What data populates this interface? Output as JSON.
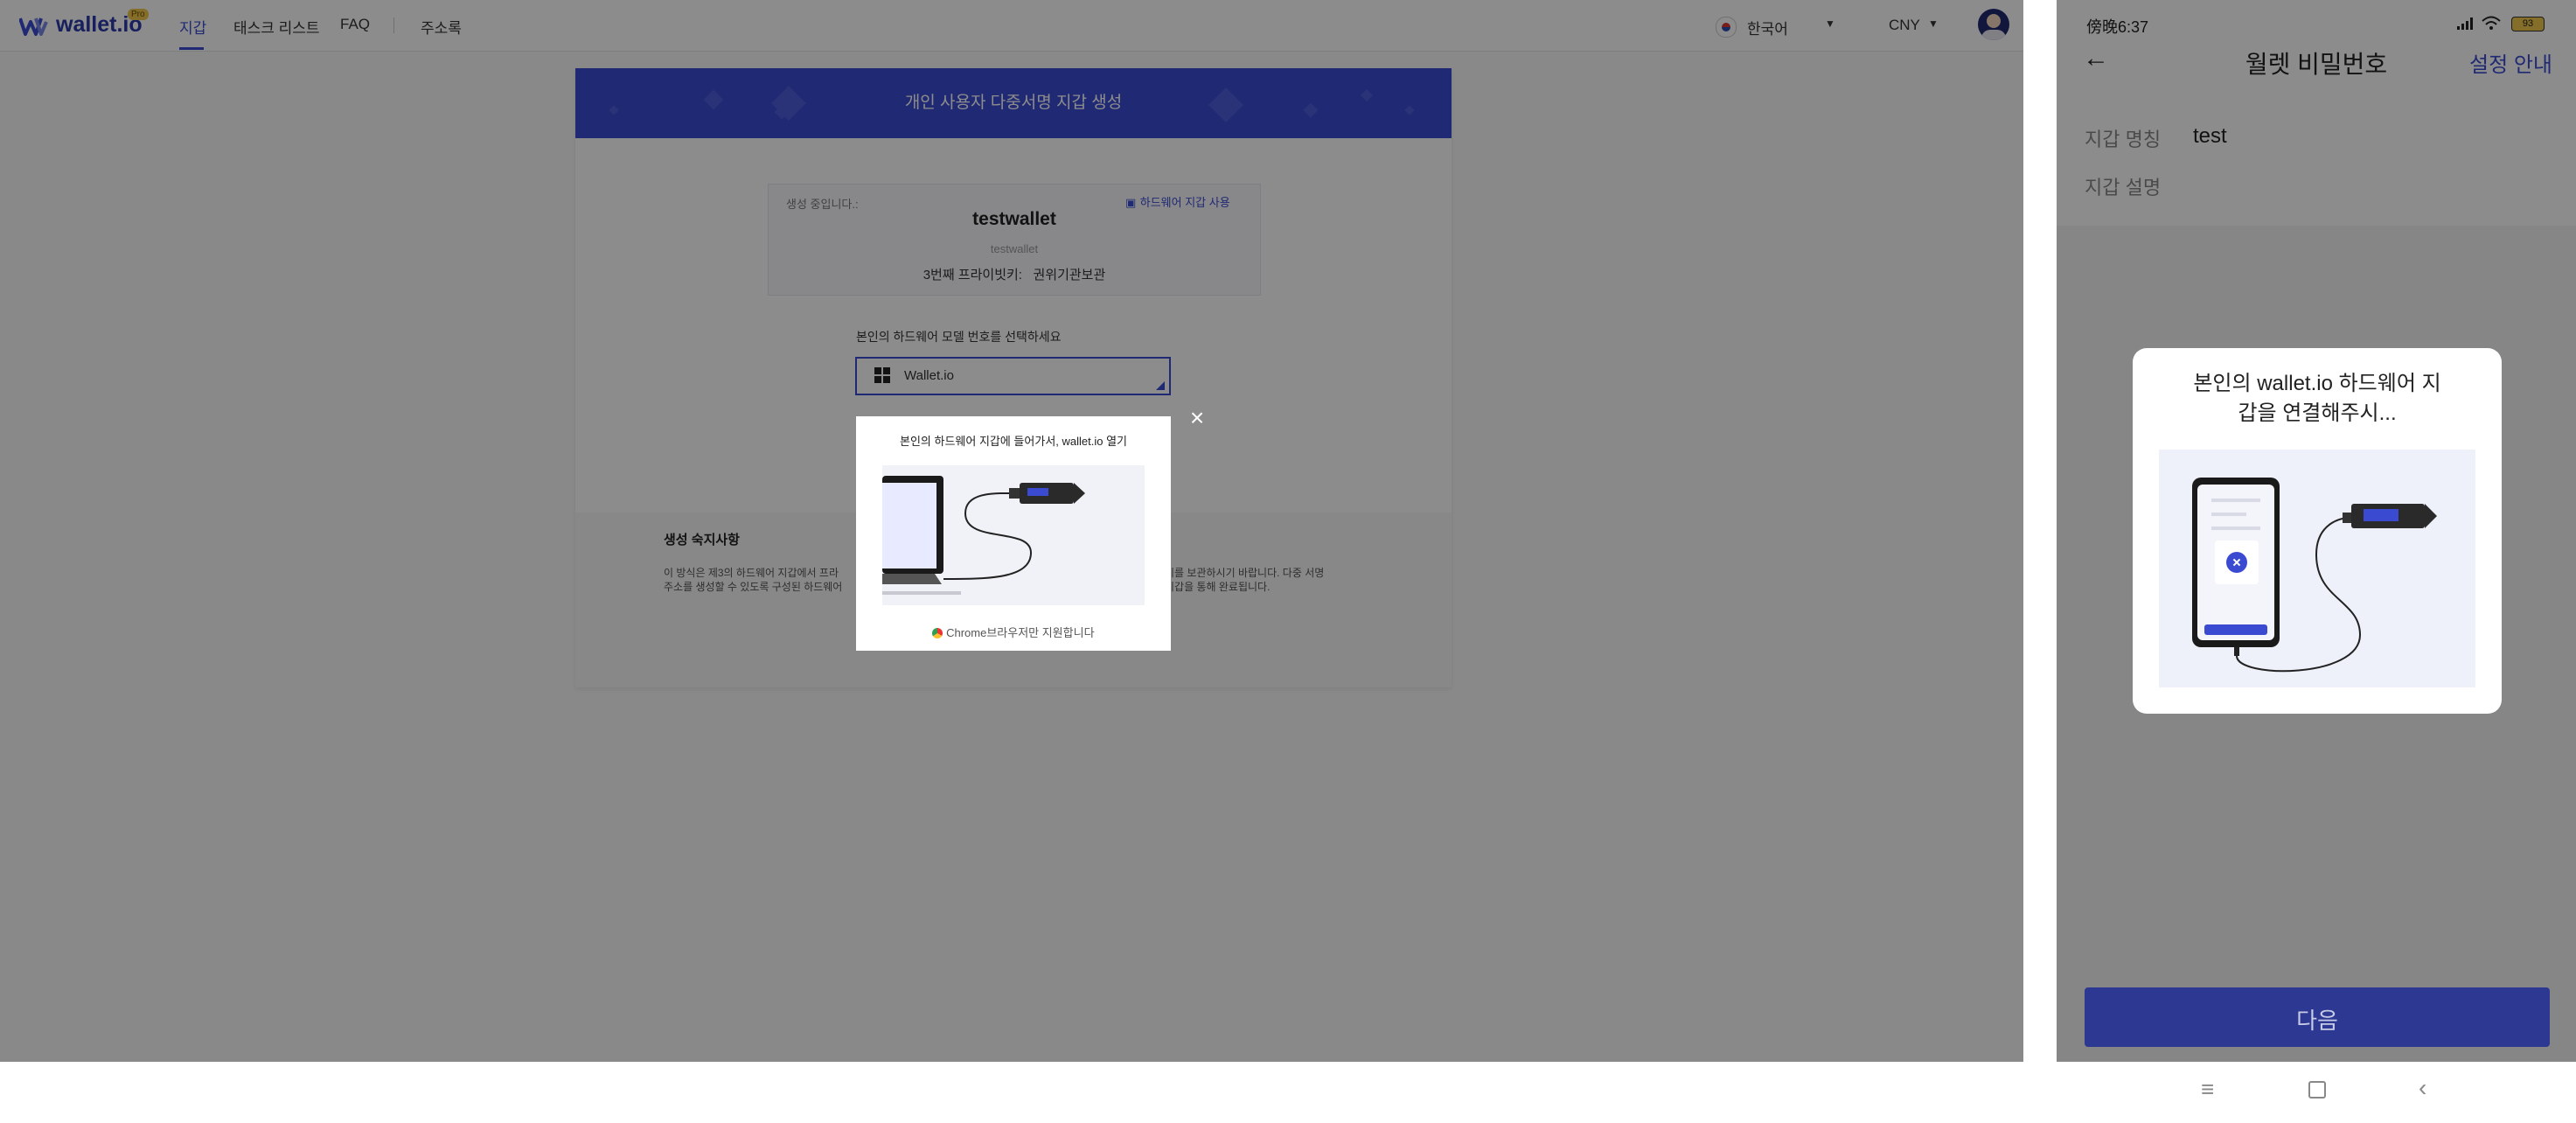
{
  "desktop": {
    "logo": {
      "text": "wallet.io",
      "badge": "Pro"
    },
    "nav": {
      "items": [
        {
          "label": "지갑",
          "active": true
        },
        {
          "label": "태스크 리스트",
          "active": false
        },
        {
          "label": "FAQ",
          "active": false
        },
        {
          "label": "주소록",
          "active": false
        }
      ],
      "language": "한국어",
      "currency": "CNY"
    },
    "card": {
      "title": "개인 사용자 다중서명 지갑 생성",
      "creating_label": "생성 중입니다.:",
      "hw_link": "하드웨어 지갑 사용",
      "wallet_name": "testwallet",
      "wallet_desc": "testwallet",
      "third_key_label": "3번째 프라이빗키:",
      "third_key_value": "권위기관보관",
      "select_label": "본인의 하드웨어 모델 번호를 선택하세요",
      "select_value": "Wallet.io",
      "notes_title": "생성 숙지사항",
      "notes_line1_a": "이 방식은 제3의 하드웨어 지갑에서 프라",
      "notes_line1_b": "키를 보관하시기 바랍니다. 다중 서명",
      "notes_line2_a": "주소를 생성할 수 있도록 구성된 하드웨어",
      "notes_line2_b": "지갑을 통해 완료됩니다."
    },
    "modal": {
      "title": "본인의 하드웨어 지갑에 들어가서, wallet.io 열기",
      "footer": "Chrome브라우저만 지원합니다"
    }
  },
  "phone": {
    "status": {
      "time": "傍晚6:37",
      "battery": "93"
    },
    "header": {
      "title": "월렛 비밀번호",
      "action": "설정 안내"
    },
    "fields": [
      {
        "label": "지갑 명칭",
        "value": "test"
      },
      {
        "label": "지갑 설명",
        "value": ""
      }
    ],
    "dialog": {
      "title": "본인의 wallet.io 하드웨어 지갑을 연결해주시..."
    },
    "next_button": "다음"
  },
  "icons": [
    "logo-icon",
    "flag-icon",
    "dropdown-icon",
    "avatar-icon",
    "card-icon",
    "wallet-model-icon",
    "close-icon",
    "chrome-icon",
    "back-arrow-icon",
    "signal-icon",
    "wifi-icon",
    "battery-icon",
    "menu-icon",
    "home-icon",
    "back-icon"
  ],
  "colors": {
    "primary": "#3b4bd1",
    "phone_button": "#2c3892",
    "overlay": "rgba(0,0,0,0.45)"
  }
}
